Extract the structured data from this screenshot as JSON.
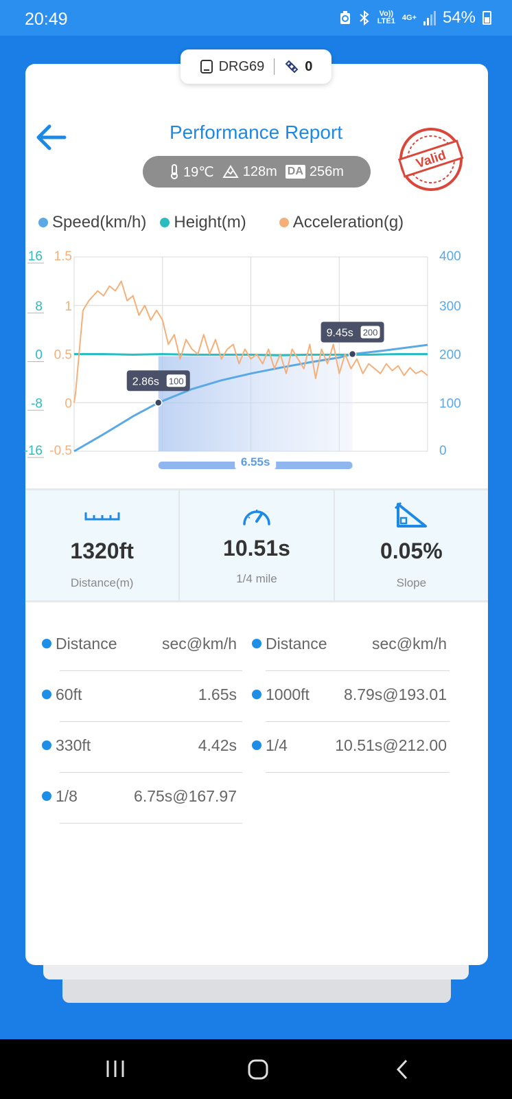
{
  "status": {
    "time": "20:49",
    "volte": "Vo))",
    "lte": "LTE1",
    "net": "4G+",
    "battery": "54%"
  },
  "device": {
    "name": "DRG69",
    "count": "0"
  },
  "header": {
    "title": "Performance Report",
    "stamp": "Valid"
  },
  "conditions": {
    "temp": "19℃",
    "altitude": "128m",
    "da_badge": "DA",
    "da_value": "256m"
  },
  "legend": [
    {
      "label": "Speed(km/h)",
      "color": "#5aa9e6"
    },
    {
      "label": "Height(m)",
      "color": "#2bbcc0"
    },
    {
      "label": "Acceleration(g)",
      "color": "#f5b07a"
    }
  ],
  "chart_data": {
    "type": "line",
    "x_unit": "s",
    "x_range": [
      0,
      12
    ],
    "axes": {
      "height_ticks": [
        "16",
        "8",
        "0",
        "-8",
        "-16"
      ],
      "accel_ticks": [
        "1.5",
        "1",
        "0.5",
        "0",
        "-0.5"
      ],
      "speed_ticks": [
        "400",
        "300",
        "200",
        "100",
        "0"
      ]
    },
    "series": [
      {
        "name": "Speed(km/h)",
        "axis": "speed",
        "color": "#5aa9e6",
        "x": [
          0,
          1,
          2,
          2.86,
          4,
          5,
          6,
          7,
          8,
          9,
          9.45,
          10.5,
          12
        ],
        "y": [
          0,
          35,
          72,
          100,
          128,
          146,
          160,
          172,
          183,
          193,
          200,
          207,
          219
        ]
      },
      {
        "name": "Height(m)",
        "axis": "height",
        "color": "#2bbcc0",
        "x": [
          0,
          1,
          2,
          3,
          4,
          5,
          6,
          7,
          8,
          9,
          10,
          11,
          12
        ],
        "y": [
          0,
          0,
          -0.1,
          0,
          -0.1,
          -0.1,
          -0.1,
          -0.2,
          -0.1,
          -0.1,
          -0.1,
          0,
          0
        ]
      },
      {
        "name": "Acceleration(g)",
        "axis": "accel",
        "color": "#f5b07a",
        "x": [
          0,
          0.05,
          0.3,
          0.5,
          0.8,
          1,
          1.2,
          1.4,
          1.6,
          1.8,
          2,
          2.2,
          2.4,
          2.6,
          2.8,
          3,
          3.2,
          3.4,
          3.6,
          3.8,
          4,
          4.2,
          4.4,
          4.6,
          4.8,
          5,
          5.2,
          5.4,
          5.6,
          5.8,
          6,
          6.2,
          6.4,
          6.6,
          6.8,
          7,
          7.2,
          7.4,
          7.6,
          7.8,
          8,
          8.2,
          8.4,
          8.6,
          8.8,
          9,
          9.2,
          9.4,
          9.6,
          9.8,
          10,
          10.2,
          10.4,
          10.6,
          10.8,
          11,
          11.2,
          11.4,
          11.6,
          11.8,
          12
        ],
        "y": [
          0,
          0.1,
          0.95,
          1.05,
          1.15,
          1.1,
          1.2,
          1.15,
          1.25,
          1.05,
          1.1,
          0.9,
          1.0,
          0.85,
          0.95,
          0.85,
          0.6,
          0.7,
          0.45,
          0.65,
          0.55,
          0.5,
          0.7,
          0.5,
          0.65,
          0.45,
          0.55,
          0.6,
          0.4,
          0.55,
          0.45,
          0.5,
          0.4,
          0.55,
          0.35,
          0.5,
          0.3,
          0.55,
          0.45,
          0.35,
          0.6,
          0.25,
          0.55,
          0.4,
          0.6,
          0.3,
          0.5,
          0.35,
          0.45,
          0.3,
          0.4,
          0.35,
          0.3,
          0.4,
          0.33,
          0.38,
          0.28,
          0.36,
          0.3,
          0.33,
          0.28
        ]
      }
    ],
    "markers": [
      {
        "x": 2.86,
        "y": 100,
        "label": "2.86s",
        "badge": "100"
      },
      {
        "x": 9.45,
        "y": 200,
        "label": "9.45s",
        "badge": "200"
      }
    ],
    "range": {
      "start": 2.86,
      "end": 9.45,
      "label": "6.55s"
    }
  },
  "metrics": [
    {
      "value": "1320ft",
      "label": "Distance(m)",
      "icon": "ruler-icon"
    },
    {
      "value": "10.51s",
      "label": "1/4 mile",
      "icon": "speedometer-icon"
    },
    {
      "value": "0.05%",
      "label": "Slope",
      "icon": "slope-icon"
    }
  ],
  "splits": {
    "header": {
      "left_name": "Distance",
      "left_value": "sec@km/h",
      "right_name": "Distance",
      "right_value": "sec@km/h"
    },
    "rows": [
      {
        "left_name": "60ft",
        "left_value": "1.65s",
        "right_name": "1000ft",
        "right_value": "8.79s@193.01"
      },
      {
        "left_name": "330ft",
        "left_value": "4.42s",
        "right_name": "1/4",
        "right_value": "10.51s@212.00"
      },
      {
        "left_name": "1/8",
        "left_value": "6.75s@167.97",
        "right_name": "",
        "right_value": ""
      }
    ]
  }
}
